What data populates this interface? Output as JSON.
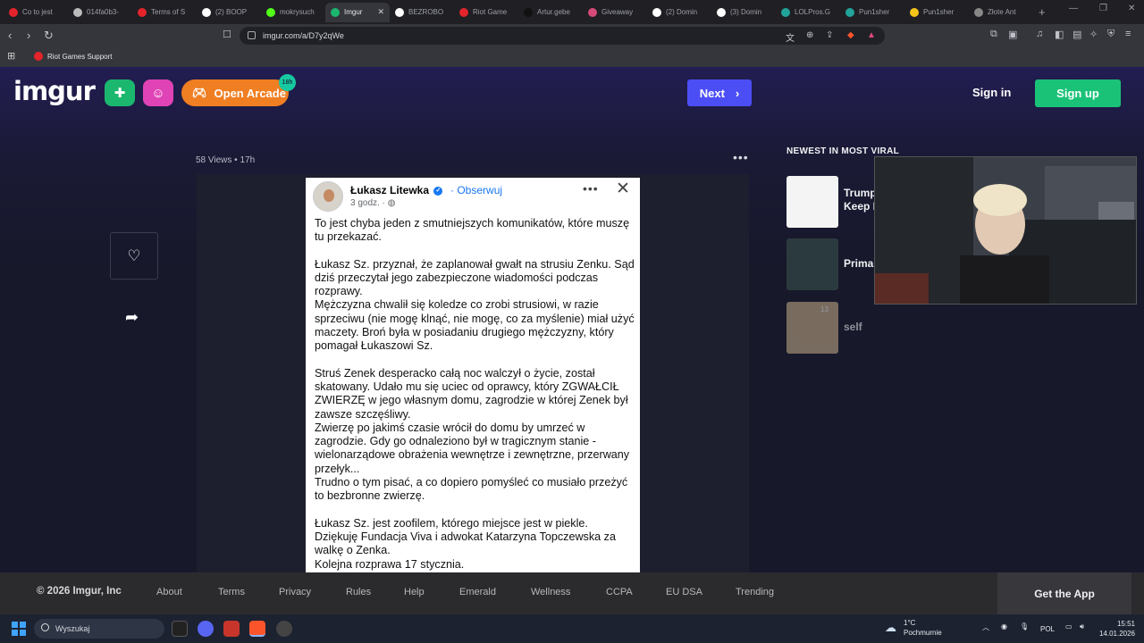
{
  "browser": {
    "tabs": [
      {
        "label": "Co to jest",
        "color": "#e3242b",
        "active": false
      },
      {
        "label": "014fa0b3-",
        "color": "#bbbbbb",
        "active": false
      },
      {
        "label": "Terms of S",
        "color": "#e3242b",
        "active": false
      },
      {
        "label": "(2) BOOP",
        "color": "#ffffff",
        "active": false
      },
      {
        "label": "mokrysuch",
        "color": "#53fc18",
        "active": false
      },
      {
        "label": "Imgur",
        "color": "#1bb76e",
        "active": true
      },
      {
        "label": "BEZROBO",
        "color": "#ffffff",
        "active": false
      },
      {
        "label": "Riot Game",
        "color": "#e3242b",
        "active": false
      },
      {
        "label": "Artur.gebe",
        "color": "#111111",
        "active": false
      },
      {
        "label": "Giveaway",
        "color": "#d64a7a",
        "active": false
      },
      {
        "label": "(2) Domin",
        "color": "#ffffff",
        "active": false
      },
      {
        "label": "(3) Domin",
        "color": "#ffffff",
        "active": false
      },
      {
        "label": "LOLPros.G",
        "color": "#21a39a",
        "active": false
      },
      {
        "label": "Pun1sher",
        "color": "#21a39a",
        "active": false
      },
      {
        "label": "Pun1sher",
        "color": "#f5c518",
        "active": false
      },
      {
        "label": "Złote Ant",
        "color": "#888888",
        "active": false
      }
    ],
    "url": "imgur.com/a/D7y2qWe",
    "bookmark": "Riot Games Support"
  },
  "header": {
    "logo": "imgur",
    "arcade_label": "Open Arcade",
    "arcade_badge": "18h",
    "next_label": "Next",
    "signin_label": "Sign in",
    "signup_label": "Sign up"
  },
  "post": {
    "meta": "58 Views • 17h",
    "card": {
      "author": "Łukasz Litewka",
      "follow": "Obserwuj",
      "time": "3 godz. ·",
      "paragraphs": [
        "To jest chyba jeden z smutniejszych komunikatów, które muszę tu przekazać.",
        "",
        "Łukasz Sz. przyznał, że zaplanował gwałt na strusiu Zenku. Sąd dziś przeczytał jego zabezpieczone wiadomości podczas rozprawy.",
        "Mężczyzna chwalił się koledze co zrobi strusiowi, w razie sprzeciwu (nie mogę klnąć, nie mogę, co za myślenie) miał użyć maczety. Broń była w posiadaniu drugiego mężczyzny, który pomagał Łukaszowi Sz.",
        "",
        "Struś Zenek desperacko całą noc walczył o życie, został skatowany. Udało mu się uciec od oprawcy, który ZGWAŁCIŁ ZWIERZĘ w jego własnym domu, zagrodzie w której Zenek był zawsze szczęśliwy.",
        "Zwierzę po jakimś czasie wrócił do domu by umrzeć w zagrodzie. Gdy go odnaleziono był w tragicznym stanie - wielonarządowe obrażenia wewnętrze i zewnętrzne, przerwany przełyk...",
        "Trudno o tym pisać, a co dopiero pomyśleć co musiało przeżyć to bezbronne zwierzę.",
        "",
        "Łukasz Sz. jest zoofilem, którego miejsce jest w piekle.",
        "Dziękuję Fundacja Viva i adwokat Katarzyna Topczewska za walkę o Zenka.",
        "Kolejna rozprawa 17 stycznia."
      ]
    }
  },
  "sidebar": {
    "title": "NEWEST IN MOST VIRAL",
    "items": [
      {
        "title": "Trump\nKeep I",
        "badge": ""
      },
      {
        "title": "Prima",
        "badge": ""
      },
      {
        "title": "self",
        "badge": "13"
      }
    ]
  },
  "footer": {
    "copyright": "© 2026 Imgur, Inc",
    "links": [
      "About",
      "Terms",
      "Privacy",
      "Rules",
      "Help",
      "Emerald",
      "Wellness",
      "CCPA",
      "EU DSA",
      "Trending"
    ],
    "get_app": "Get the App"
  },
  "taskbar": {
    "search_placeholder": "Wyszukaj",
    "weather_temp": "1°C",
    "weather_desc": "Pochmurnie",
    "lang": "POL",
    "time": "15:51",
    "date": "14.01.2026"
  }
}
